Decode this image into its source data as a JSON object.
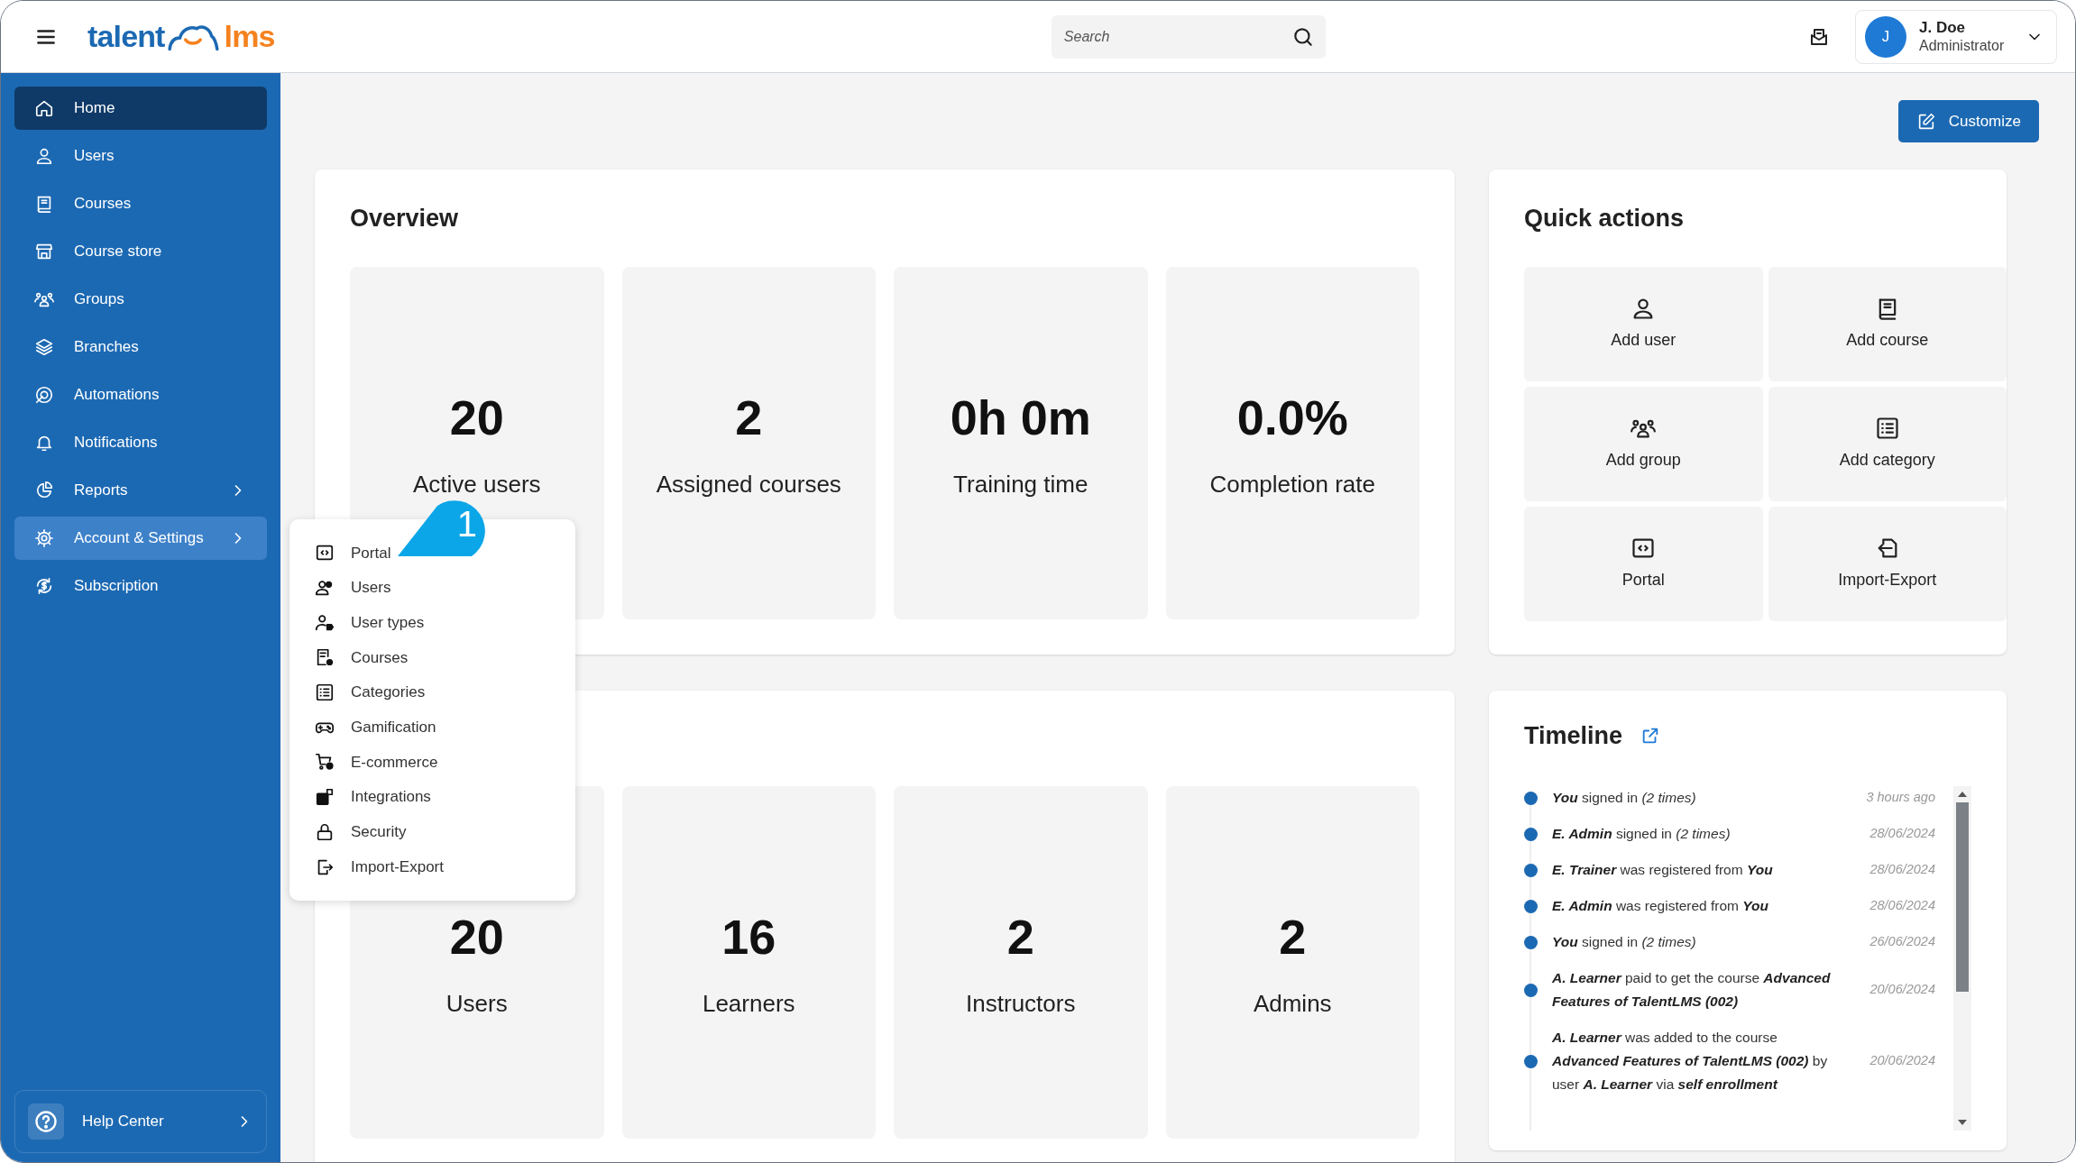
{
  "header": {
    "logo": {
      "left": "talent",
      "right": "lms"
    },
    "search": {
      "placeholder": "Search"
    },
    "user": {
      "initial": "J",
      "name": "J. Doe",
      "role": "Administrator"
    }
  },
  "sidebar": {
    "items": [
      {
        "label": "Home",
        "selected": true,
        "expanded": false,
        "submenu": false
      },
      {
        "label": "Users",
        "selected": false,
        "expanded": false,
        "submenu": false
      },
      {
        "label": "Courses",
        "selected": false,
        "expanded": false,
        "submenu": false
      },
      {
        "label": "Course store",
        "selected": false,
        "expanded": false,
        "submenu": false
      },
      {
        "label": "Groups",
        "selected": false,
        "expanded": false,
        "submenu": false
      },
      {
        "label": "Branches",
        "selected": false,
        "expanded": false,
        "submenu": false
      },
      {
        "label": "Automations",
        "selected": false,
        "expanded": false,
        "submenu": false
      },
      {
        "label": "Notifications",
        "selected": false,
        "expanded": false,
        "submenu": false
      },
      {
        "label": "Reports",
        "selected": false,
        "expanded": false,
        "submenu": true
      },
      {
        "label": "Account & Settings",
        "selected": false,
        "expanded": true,
        "submenu": true
      },
      {
        "label": "Subscription",
        "selected": false,
        "expanded": false,
        "submenu": false
      }
    ],
    "help": {
      "label": "Help Center"
    }
  },
  "customize_button": "Customize",
  "overview": {
    "title": "Overview",
    "stats": [
      {
        "value": "20",
        "label": "Active users"
      },
      {
        "value": "2",
        "label": "Assigned courses"
      },
      {
        "value": "0h 0m",
        "label": "Training time"
      },
      {
        "value": "0.0%",
        "label": "Completion rate"
      }
    ]
  },
  "quick_actions": {
    "title": "Quick actions",
    "actions": [
      "Add user",
      "Add course",
      "Add group",
      "Add category",
      "Portal",
      "Import-Export"
    ]
  },
  "users_panel": {
    "stats": [
      {
        "value": "20",
        "label": "Users"
      },
      {
        "value": "16",
        "label": "Learners"
      },
      {
        "value": "2",
        "label": "Instructors"
      },
      {
        "value": "2",
        "label": "Admins"
      }
    ]
  },
  "timeline": {
    "title": "Timeline",
    "entries": [
      {
        "text": "**You** signed in *(2 times)*",
        "time": "3 hours ago"
      },
      {
        "text": "**E. Admin** signed in *(2 times)*",
        "time": "28/06/2024"
      },
      {
        "text": "**E. Trainer** was registered from **You**",
        "time": "28/06/2024"
      },
      {
        "text": "**E. Admin** was registered from **You**",
        "time": "28/06/2024"
      },
      {
        "text": "**You** signed in *(2 times)*",
        "time": "26/06/2024"
      },
      {
        "text": "**A. Learner** paid to get the course **Advanced Features of TalentLMS (002)**",
        "time": "20/06/2024"
      },
      {
        "text": "**A. Learner** was added to the course **Advanced Features of TalentLMS (002)** by user **A. Learner** via **self enrollment**",
        "time": "20/06/2024"
      }
    ]
  },
  "settings_menu": {
    "items": [
      "Portal",
      "Users",
      "User types",
      "Courses",
      "Categories",
      "Gamification",
      "E-commerce",
      "Integrations",
      "Security",
      "Import-Export"
    ]
  },
  "callout": {
    "label": "1"
  }
}
